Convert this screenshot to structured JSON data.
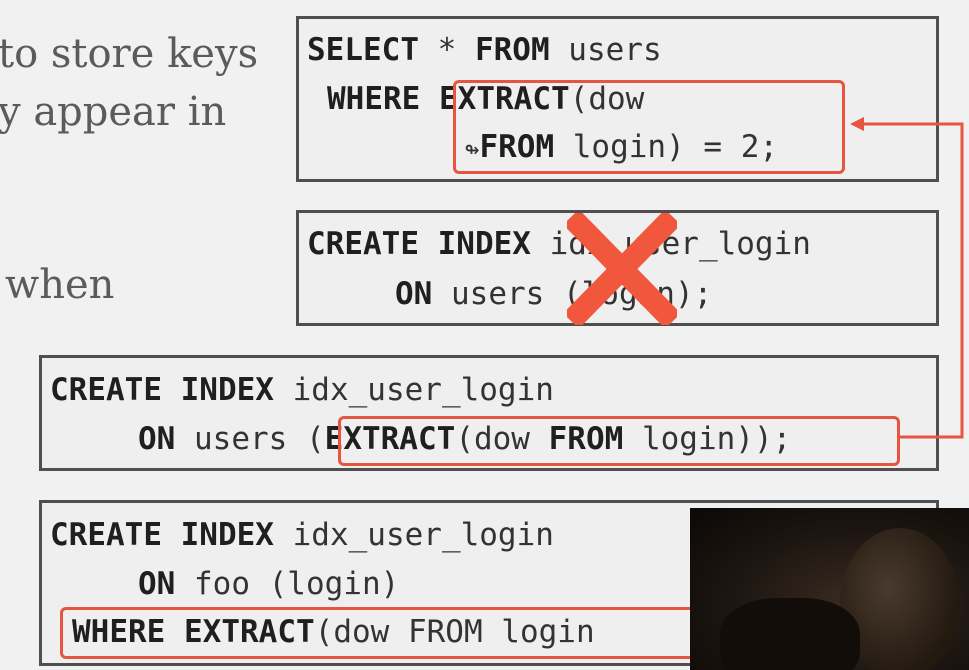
{
  "background_text": {
    "line1": "to store keys",
    "line2": "y appear in",
    "line3": "when"
  },
  "panel1": {
    "l1_kw1": "SELECT",
    "l1_rest": " * ",
    "l1_kw2": "FROM",
    "l1_tail": " users",
    "l2_kw": "WHERE",
    "l2_kw2": "EXTRACT",
    "l2_tail": "(dow",
    "l3_symbol": "↬",
    "l3_kw": "FROM",
    "l3_tail": " login) = 2;"
  },
  "panel2": {
    "l1_kw": "CREATE INDEX",
    "l1_tail": " idx_user_login",
    "l2_kw": "ON",
    "l2_tail": " users (login);",
    "cross_mark": "X"
  },
  "panel3": {
    "l1_kw": "CREATE INDEX",
    "l1_tail": " idx_user_login",
    "l2_kw": "ON",
    "l2_mid": " users ",
    "l2_paren": "(",
    "l2_kw2": "EXTRACT",
    "l2_dow": "(dow ",
    "l2_kw3": "FROM",
    "l2_tail": " login));"
  },
  "panel4": {
    "l1_kw": "CREATE INDEX",
    "l1_tail": " idx_user_login",
    "l2_kw": "ON",
    "l2_tail": " foo (login)",
    "l3_kw1": "WHERE",
    "l3_kw2": "EXTRACT",
    "l3_tail": "(dow FROM login"
  },
  "colors": {
    "highlight": "#e5553f",
    "border": "#4f4f4f"
  }
}
